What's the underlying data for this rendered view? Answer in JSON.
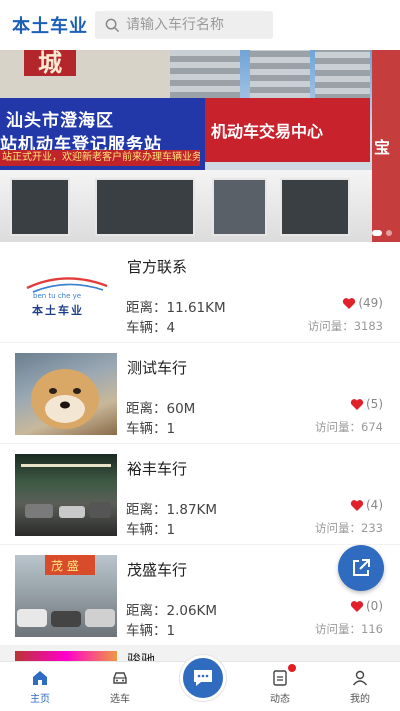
{
  "header": {
    "logo": "本土车业",
    "search_placeholder": "请输入车行名称"
  },
  "banner": {
    "sign_top": "城",
    "blue_line1": "汕头市澄海区",
    "blue_line2": "站机动车登记服务站",
    "strip": "站正式开业，欢迎新老客户前来办理车辆业务！",
    "red_sign": "机动车交易中心",
    "side_sign": "宝"
  },
  "dealers": [
    {
      "name": "官方联系",
      "distance": "距离：11.61KM",
      "vehicles": "车辆：4",
      "likes": "(49)",
      "visits": "访问量：3183",
      "logo_text": "本土车业",
      "logo_sub": "ben tu che ye"
    },
    {
      "name": "测试车行",
      "distance": "距离：60M",
      "vehicles": "车辆：1",
      "likes": "(5)",
      "visits": "访问量：674"
    },
    {
      "name": "裕丰车行",
      "distance": "距离：1.87KM",
      "vehicles": "车辆：1",
      "likes": "(4)",
      "visits": "访问量：233"
    },
    {
      "name": "茂盛车行",
      "distance": "距离：2.06KM",
      "vehicles": "车辆：1",
      "likes": "(0)",
      "visits": "访问量：116",
      "thumb_sign": "茂 盛"
    }
  ],
  "peek_item": {
    "name": "骏驰"
  },
  "tabbar": {
    "home": "主页",
    "pick_car": "选车",
    "feed": "动态",
    "mine": "我的"
  },
  "colors": {
    "brand": "#2f6cc0",
    "like": "#e0202a"
  }
}
